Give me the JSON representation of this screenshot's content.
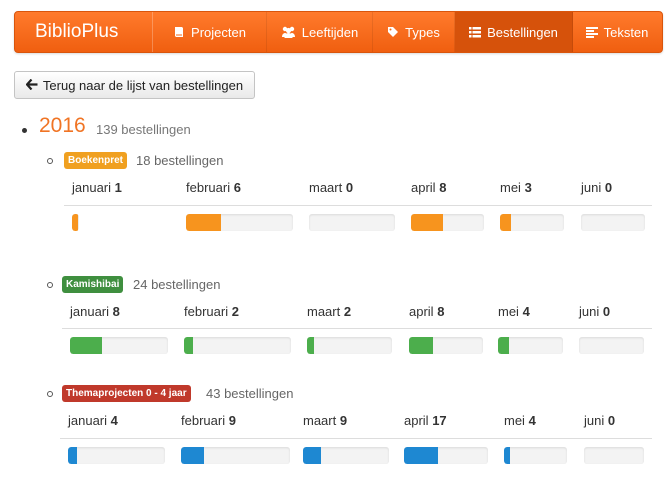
{
  "navbar": {
    "brand": "BiblioPlus",
    "items": [
      {
        "label": "Projecten",
        "icon": "book-icon",
        "active": false
      },
      {
        "label": "Leeftijden",
        "icon": "users-icon",
        "active": false
      },
      {
        "label": "Types",
        "icon": "tag-icon",
        "active": false
      },
      {
        "label": "Bestellingen",
        "icon": "list-icon",
        "active": true
      },
      {
        "label": "Teksten",
        "icon": "align-left-icon",
        "active": false
      }
    ]
  },
  "back_button": {
    "label": "Terug naar de lijst van bestellingen",
    "icon": "arrow-left-icon"
  },
  "year": {
    "value": "2016",
    "count_label": "139 bestellingen"
  },
  "colors": {
    "orange": "#f7941e",
    "green": "#449d44",
    "red": "#c9302c",
    "blue": "#1e88d2"
  },
  "groups": [
    {
      "badge": "Boekenpret",
      "badge_color": "#f0a020",
      "fill_color": "#f7941e",
      "count_label": "18 bestellingen",
      "months": [
        {
          "name": "januari",
          "count": "1",
          "fraction": 0.08
        },
        {
          "name": "februari",
          "count": "6",
          "fraction": 0.33
        },
        {
          "name": "maart",
          "count": "0",
          "fraction": 0
        },
        {
          "name": "april",
          "count": "8",
          "fraction": 0.44
        },
        {
          "name": "mei",
          "count": "3",
          "fraction": 0.17
        },
        {
          "name": "juni",
          "count": "0",
          "fraction": 0
        }
      ]
    },
    {
      "badge": "Kamishibai",
      "badge_color": "#3f8f3f",
      "fill_color": "#4cae4c",
      "count_label": "24 bestellingen",
      "months": [
        {
          "name": "januari",
          "count": "8",
          "fraction": 0.33
        },
        {
          "name": "februari",
          "count": "2",
          "fraction": 0.08
        },
        {
          "name": "maart",
          "count": "2",
          "fraction": 0.08
        },
        {
          "name": "april",
          "count": "8",
          "fraction": 0.33
        },
        {
          "name": "mei",
          "count": "4",
          "fraction": 0.17
        },
        {
          "name": "juni",
          "count": "0",
          "fraction": 0
        }
      ]
    },
    {
      "badge": "Themaprojecten 0 - 4 jaar",
      "badge_color": "#c0392b",
      "fill_color": "#1e88d2",
      "count_label": "43 bestellingen",
      "months": [
        {
          "name": "januari",
          "count": "4",
          "fraction": 0.09
        },
        {
          "name": "februari",
          "count": "9",
          "fraction": 0.21
        },
        {
          "name": "maart",
          "count": "9",
          "fraction": 0.21
        },
        {
          "name": "april",
          "count": "17",
          "fraction": 0.4
        },
        {
          "name": "mei",
          "count": "4",
          "fraction": 0.09
        },
        {
          "name": "juni",
          "count": "0",
          "fraction": 0
        }
      ]
    }
  ]
}
